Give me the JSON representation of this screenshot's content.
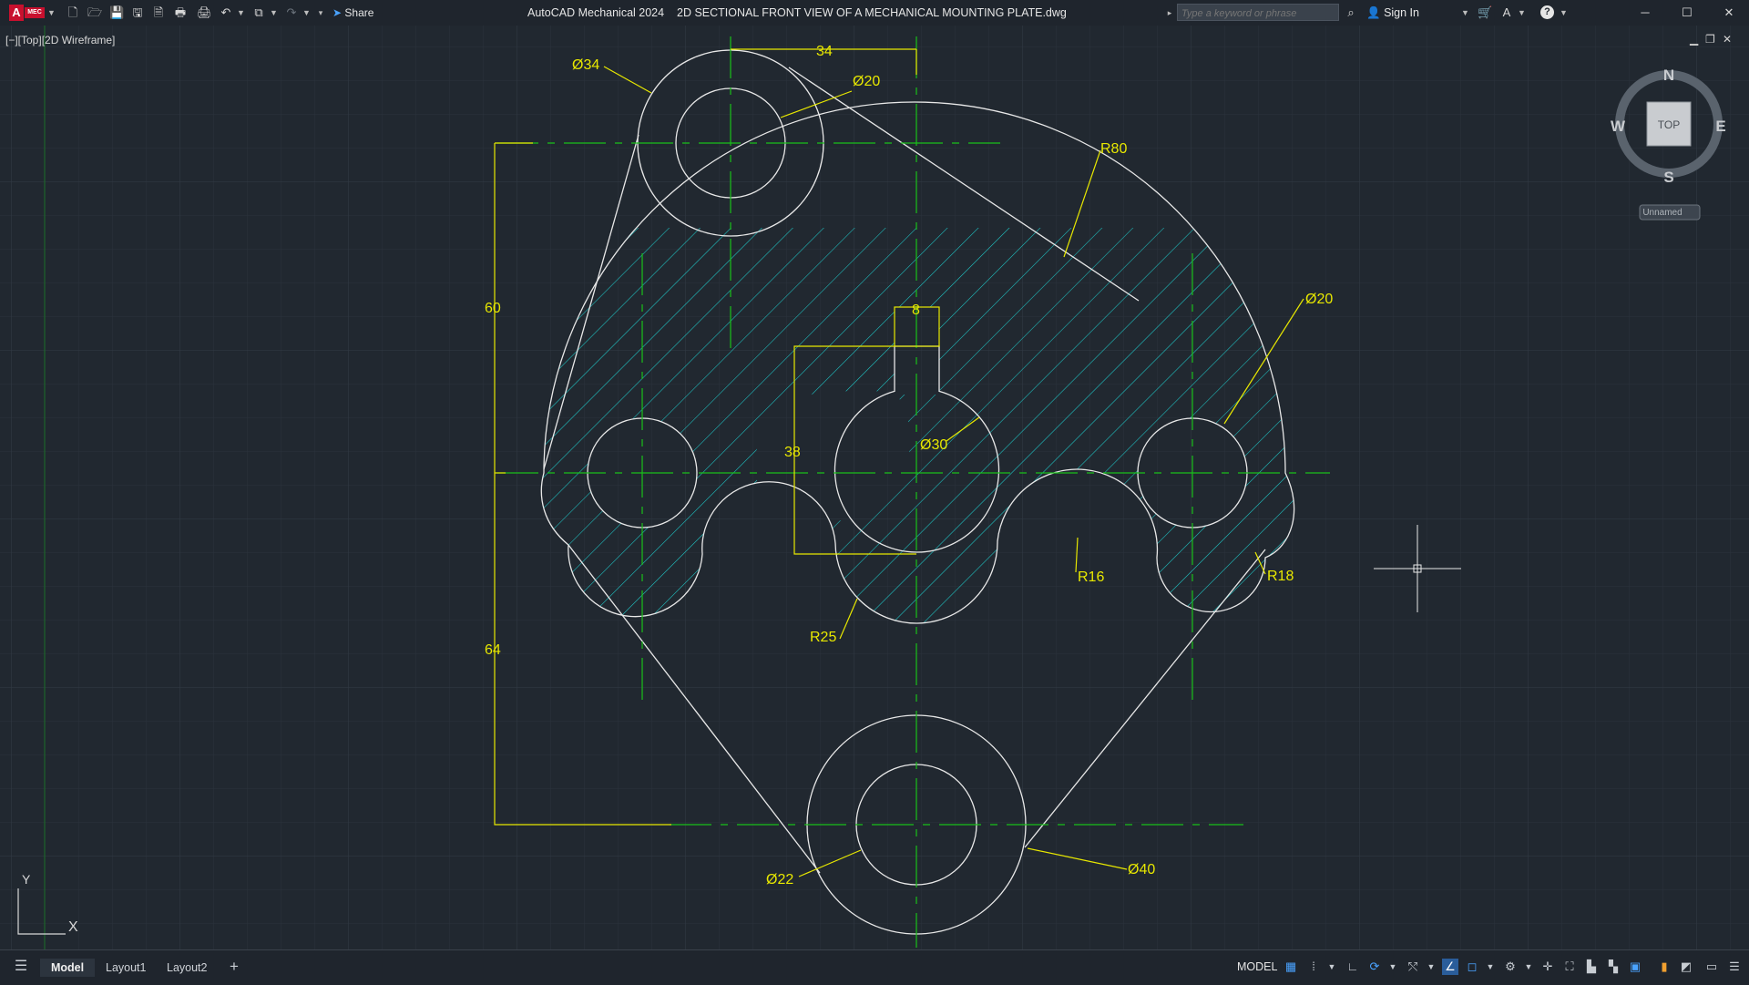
{
  "app": {
    "name": "AutoCAD Mechanical 2024",
    "file": "2D SECTIONAL FRONT VIEW OF A MECHANICAL MOUNTING PLATE.dwg",
    "logo_text": "MEC"
  },
  "toolbar": {
    "share_label": "Share",
    "search_placeholder": "Type a keyword or phrase",
    "sign_in_label": "Sign In"
  },
  "viewport": {
    "label": "[−][Top][2D Wireframe]",
    "viewcube": {
      "north": "N",
      "south": "S",
      "east": "E",
      "west": "W",
      "face": "TOP",
      "ucs": "Unnamed"
    },
    "ucs_axes": {
      "x": "X",
      "y": "Y"
    }
  },
  "drawing": {
    "dims": {
      "d34": "Ø34",
      "top_dist": "34",
      "d20_top": "Ø20",
      "r80": "R80",
      "d20_right": "Ø20",
      "dim60": "60",
      "key8": "8",
      "d30": "Ø30",
      "dim38": "38",
      "r16": "R16",
      "r18": "R18",
      "r25": "R25",
      "dim64": "64",
      "d22": "Ø22",
      "d40": "Ø40"
    }
  },
  "status": {
    "tabs": [
      "Model",
      "Layout1",
      "Layout2"
    ],
    "active_tab": "Model",
    "model_button": "MODEL"
  },
  "colors": {
    "background": "#212830",
    "geometry": "#e8e8e8",
    "centerline": "#19c019",
    "dimension": "#e8e800",
    "hatch": "#1fc9c9",
    "accent": "#4aa3ff"
  }
}
